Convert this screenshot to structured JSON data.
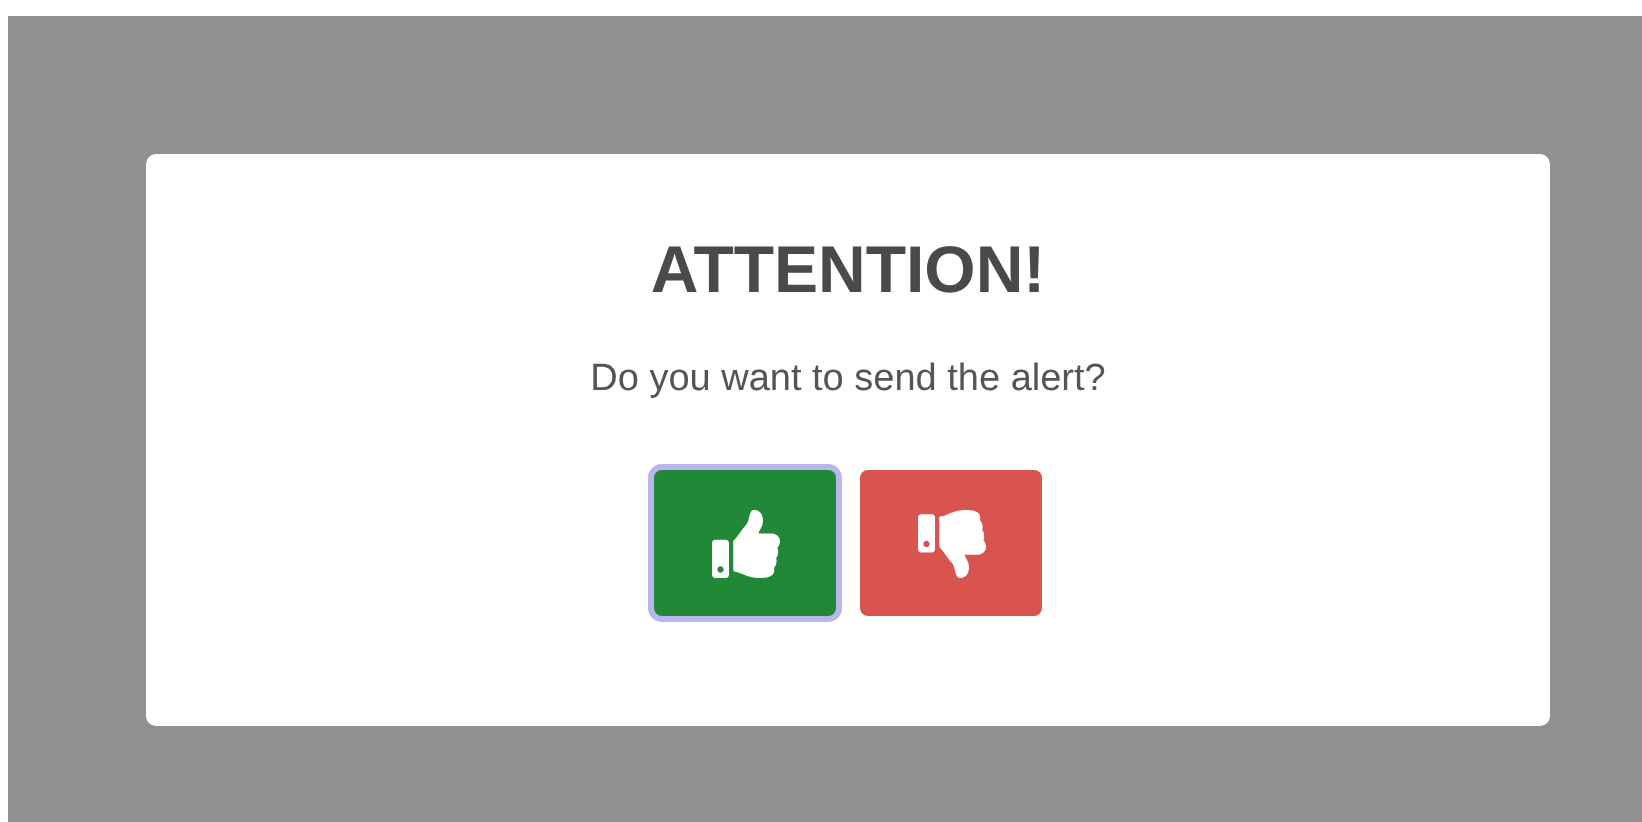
{
  "dialog": {
    "title": "ATTENTION!",
    "message": "Do you want to send the alert?",
    "buttons": [
      {
        "kind": "confirm",
        "focused": true
      },
      {
        "kind": "cancel",
        "focused": false
      }
    ]
  }
}
